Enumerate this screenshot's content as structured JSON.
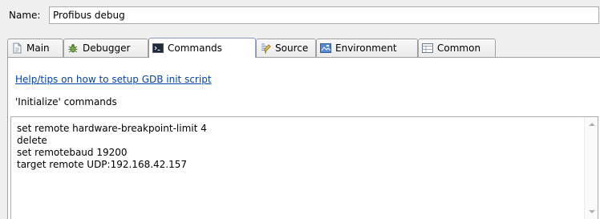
{
  "name_row": {
    "label": "Name:",
    "value": "Profibus debug"
  },
  "tabs": [
    {
      "label": "Main",
      "icon": "document-icon"
    },
    {
      "label": "Debugger",
      "icon": "bug-icon"
    },
    {
      "label": "Commands",
      "icon": "terminal-icon",
      "active": true
    },
    {
      "label": "Source",
      "icon": "source-icon"
    },
    {
      "label": "Environment",
      "icon": "environment-icon"
    },
    {
      "label": "Common",
      "icon": "table-icon"
    }
  ],
  "panel": {
    "help_link": "Help/tips on how to setup GDB init script",
    "section_label": "'Initialize' commands",
    "commands": "set remote hardware-breakpoint-limit 4\ndelete\nset remotebaud 19200\ntarget remote UDP:192.168.42.157"
  },
  "colors": {
    "link": "#0645ad",
    "tab_border": "#a0a0a0",
    "background": "#f0f0f0"
  }
}
